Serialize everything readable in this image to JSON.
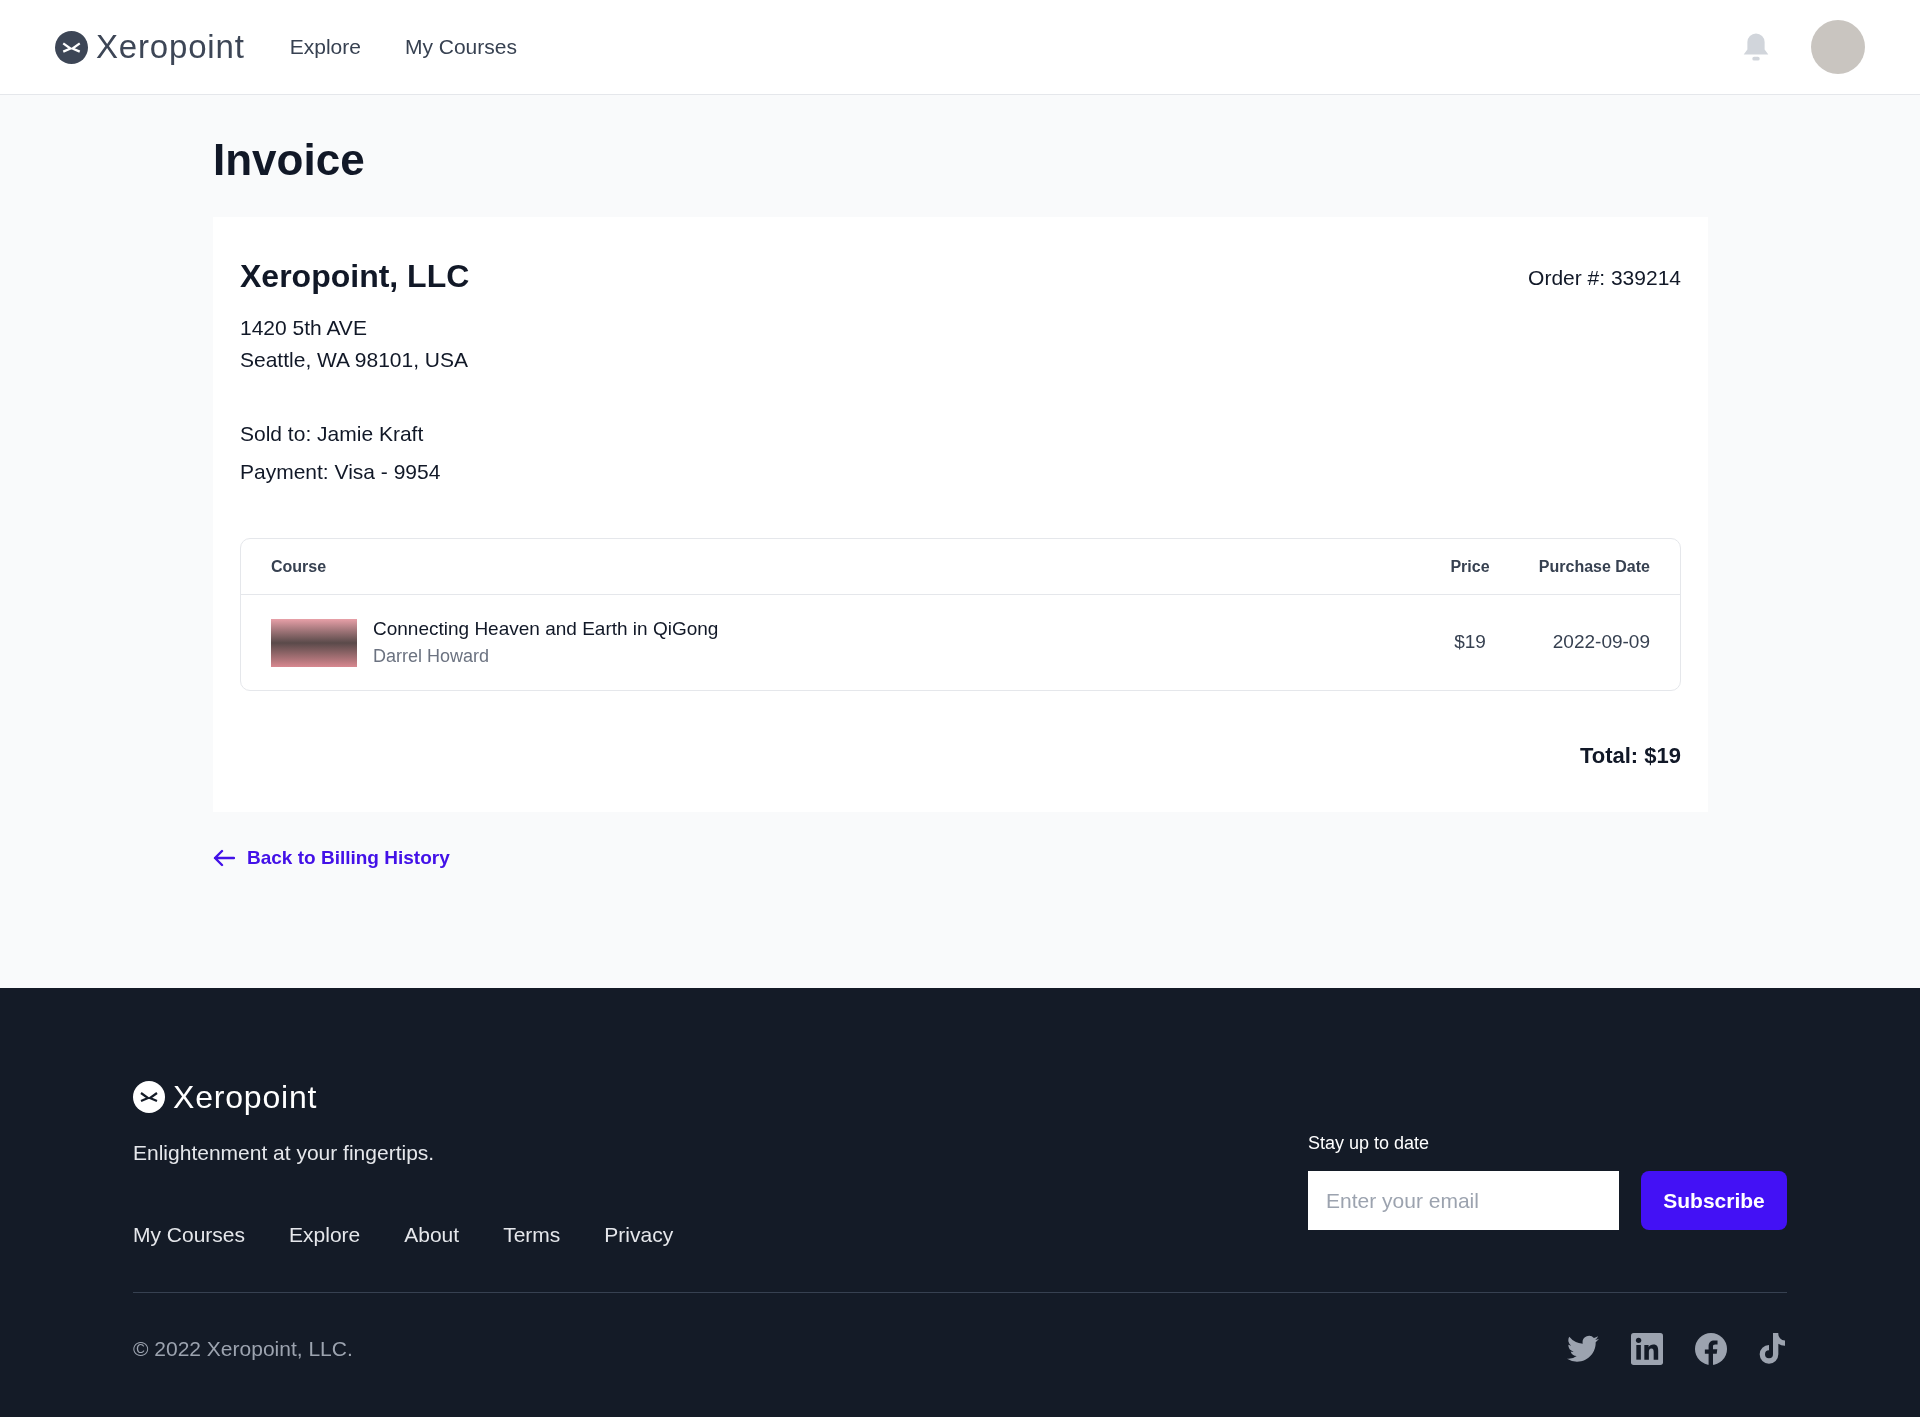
{
  "header": {
    "brand": "Xeropoint",
    "nav": [
      "Explore",
      "My Courses"
    ]
  },
  "page_title": "Invoice",
  "invoice": {
    "company": "Xeropoint, LLC",
    "order": "Order #: 339214",
    "address": [
      "1420 5th AVE",
      "Seattle, WA 98101, USA"
    ],
    "sold_to": "Sold to: Jamie Kraft",
    "payment": "Payment: Visa - 9954",
    "table": {
      "columns": [
        "Course",
        "Price",
        "Purchase Date"
      ],
      "rows": [
        {
          "title": "Connecting Heaven and Earth in QiGong",
          "author": "Darrel Howard",
          "price": "$19",
          "date": "2022-09-09"
        }
      ]
    },
    "total": "Total: $19"
  },
  "back_link": "Back to Billing History",
  "footer": {
    "brand": "Xeropoint",
    "tagline": "Enlightenment at your fingertips.",
    "links": [
      "My Courses",
      "Explore",
      "About",
      "Terms",
      "Privacy"
    ],
    "newsletter": {
      "label": "Stay up to date",
      "placeholder": "Enter your email",
      "button": "Subscribe"
    },
    "copyright": "© 2022 Xeropoint, LLC."
  }
}
